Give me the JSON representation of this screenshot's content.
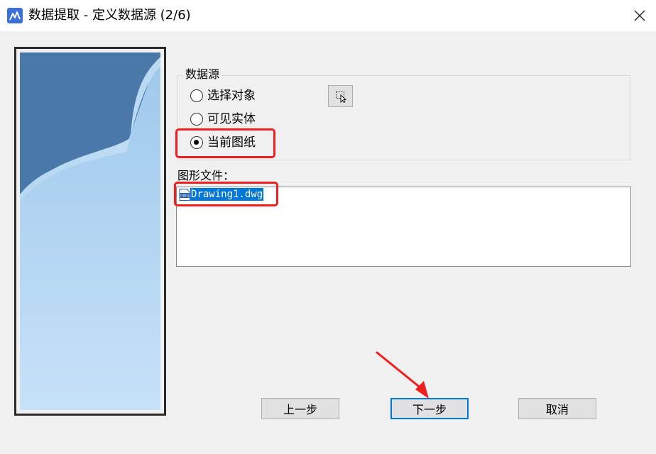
{
  "window": {
    "title": "数据提取 - 定义数据源 (2/6)"
  },
  "icons": {
    "app": "app-icon",
    "close": "close-icon",
    "pick": "pick-objects-icon",
    "file": "dwg-file-icon"
  },
  "data_source": {
    "label": "数据源",
    "options": [
      {
        "label": "选择对象",
        "checked": false
      },
      {
        "label": "可见实体",
        "checked": false
      },
      {
        "label": "当前图纸",
        "checked": true
      }
    ]
  },
  "files": {
    "label": "图形文件：",
    "items": [
      {
        "name": "Drawing1.dwg",
        "selected": true
      }
    ]
  },
  "buttons": {
    "back": "上一步",
    "next": "下一步",
    "cancel": "取消"
  },
  "colors": {
    "highlight": "#f01e1e",
    "selection": "#0078d7"
  }
}
